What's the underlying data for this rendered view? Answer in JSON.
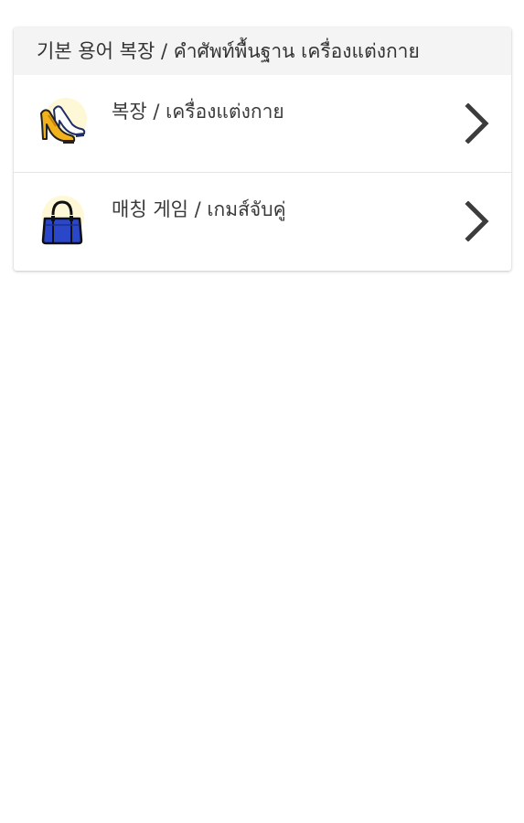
{
  "card": {
    "title": "기본 용어 복장 / คำศัพท์พื้นฐาน เครื่องแต่งกาย"
  },
  "items": [
    {
      "label": "복장 / เครื่องแต่งกาย",
      "icon": "high-heels-icon"
    },
    {
      "label": "매칭 게임 / เกมส์จับคู่",
      "icon": "handbag-icon"
    }
  ],
  "colors": {
    "header_bg": "#f4f4f4",
    "text": "#3a3a3a",
    "chevron": "#3c3c3c",
    "shoe_gold": "#f2b21c",
    "shoe_navy": "#1f2f66",
    "bag_blue": "#2a47c9",
    "icon_halo": "#fff8d6"
  }
}
